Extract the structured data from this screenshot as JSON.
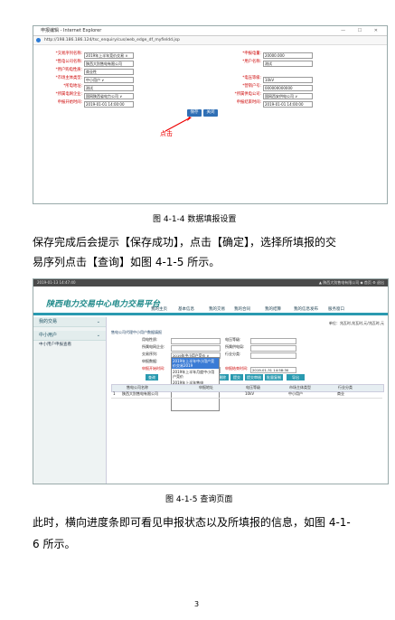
{
  "figure1": {
    "window_title": "申报编辑 - Internet Explorer",
    "window_buttons": "— ☐ ✕",
    "address": "http://198.186.186.124/tsc_enquiry/cus/web_edge_df_myfieldd.jsp",
    "left_fields": [
      {
        "label": "*交易序列名称:",
        "value": "2019年上半年竞价交易 ∨"
      },
      {
        "label": "*售电公司名称:",
        "value": "陕西大别售电有限公司"
      },
      {
        "label": "*用户购电性质:",
        "value": "商业性"
      },
      {
        "label": "*市场主体类型:",
        "value": "中小用户 ∨"
      },
      {
        "label": "*所电地址:",
        "value": "测试"
      },
      {
        "label": "*所属电网企业:",
        "value": "国网陕西省电力公司 ∨"
      },
      {
        "label": "申报开始时间:",
        "value": "2019-01-01 14:00:00"
      }
    ],
    "right_fields": [
      {
        "label": "*申报电量:",
        "value": "20000.000"
      },
      {
        "label": "*用户名称:",
        "value": "测试"
      },
      {
        "label": "*电压等级:",
        "value": "10kV"
      },
      {
        "label": "*营销户号:",
        "value": "000000000000"
      },
      {
        "label": "*所属供电公司:",
        "value": "国网西安供电公司 ∨"
      },
      {
        "label": "申报结束时间:",
        "value": "2019-01-01 14:00:00"
      }
    ],
    "save_button": "保存",
    "close_button": "关闭",
    "click_label": "点击"
  },
  "caption1": "图 4-1-4 数据填报设置",
  "paragraph1": [
    "保存完成后会提示【保存成功】，点击【确定】，选择所填报的交",
    "易序列点击【查询】如图 4-1-5 所示。"
  ],
  "figure2": {
    "topbar": "2019-01-13 14:47:40",
    "topbar_right": "▲ 陕西大别售电有限公司  ◆ 首页  ⚙ 退出",
    "portal_title": "陕西电力交易中心电力交易平台",
    "nav": [
      "我的主页",
      "基本信息",
      "我的交易",
      "我的合同",
      "我的结算",
      "我的信息发布",
      "服务窗口"
    ],
    "unit_line": "单位：兆瓦时,兆瓦时,元/兆瓦时,元",
    "sidebar": {
      "header": "我的交易",
      "group": "中小用户",
      "item": "中小用户申报查看"
    },
    "panel_title": "售电公司代理中小用户数据填报",
    "row_labels": [
      "用电性质:",
      "所属电网企业:",
      "交易序列:",
      "申报数据:",
      "申报开始时间:"
    ],
    "row_labels_right": [
      "电压等级:",
      "所属供电局:",
      "行业分类:",
      "申报结束时间:"
    ],
    "start_time": "2019-01-14 08:30:00",
    "end_time": "2019-01-31 14:58:30",
    "dropdown_options": [
      "2019年上半年中小用户竞价交易2019",
      "2019年上半年月度中小用户竞价",
      "2019年上半年售电",
      "2019年上半年竞价交易"
    ],
    "selected_option": "2019年中小用户竞价 ∨",
    "buttons": [
      "查询",
      "新增",
      "修改",
      "删除",
      "提交",
      "提交审核",
      "批量复制",
      "导出"
    ],
    "table_headers": [
      "售电公司名称",
      "申报地址",
      "电压等级",
      "市场主体类型",
      "行业分类"
    ],
    "table_row": [
      "1",
      "陕西大别售电有限公司",
      "",
      "10kV",
      "中小用户",
      "商业"
    ]
  },
  "caption2": "图 4-1-5 查询页面",
  "paragraph2": [
    "此时，横向进度条即可看见申报状态以及所填报的信息，如图 4-1-",
    "6 所示。"
  ],
  "page_number": "3"
}
